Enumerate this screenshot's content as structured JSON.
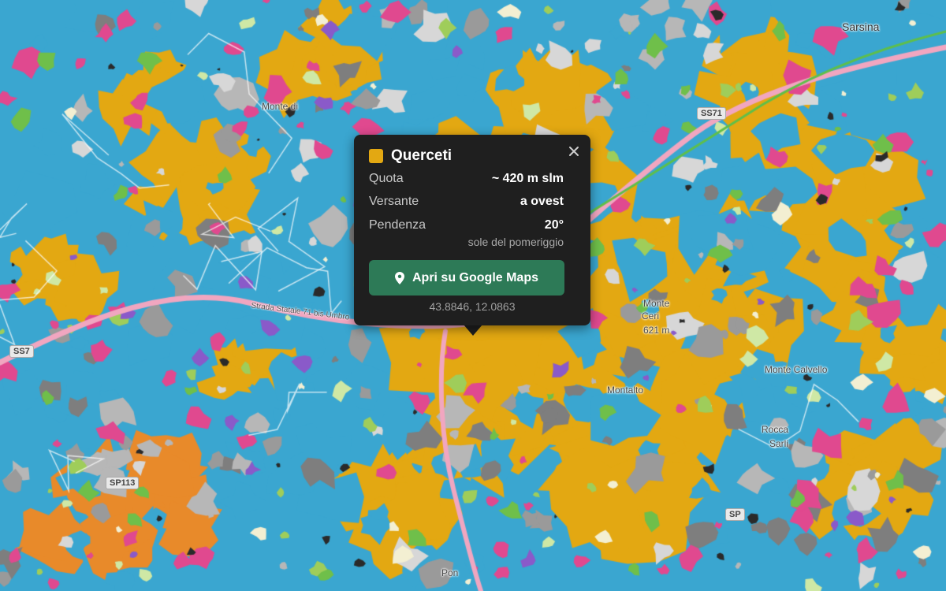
{
  "map": {
    "labels": {
      "sarsina": "Sarsina",
      "ss71": "SS71",
      "ss71_left": "SS7",
      "sp113": "SP113",
      "sp_right": "SP",
      "strada": "Strada Statale 71 bis Umbro",
      "monte_di": "Monte di",
      "monte": "Monte",
      "cerro": "Ceri",
      "quota_621": "621 m",
      "monte_calvello": "Monte Calvello",
      "rocca": "Rocca",
      "rocca_2": "Sarli",
      "montalto": "Montalto",
      "pon": "Pon"
    }
  },
  "popup": {
    "swatch_color": "#e3a812",
    "title": "Querceti",
    "close_label": "×",
    "rows": [
      {
        "key": "Quota",
        "value": "~ 420 m slm"
      },
      {
        "key": "Versante",
        "value": "a ovest"
      },
      {
        "key": "Pendenza",
        "value": "20°"
      }
    ],
    "note": "sole del pomeriggio",
    "button_label": "Apri su Google Maps",
    "coords": "43.8846, 12.0863"
  }
}
